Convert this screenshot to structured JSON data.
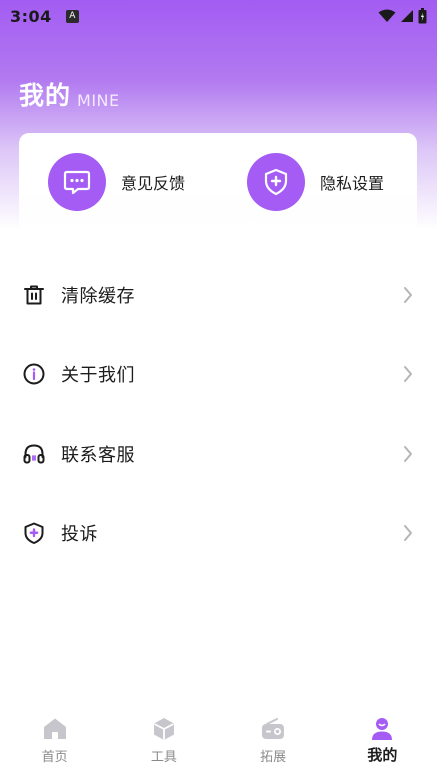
{
  "status_bar": {
    "time": "3:04",
    "notification_glyph": "A"
  },
  "header": {
    "title": "我的",
    "subtitle": "MINE"
  },
  "quick_actions": [
    {
      "label": "意见反馈",
      "icon": "chat-bubble-icon"
    },
    {
      "label": "隐私设置",
      "icon": "shield-plus-icon"
    }
  ],
  "menu": [
    {
      "label": "清除缓存",
      "icon": "trash-icon"
    },
    {
      "label": "关于我们",
      "icon": "info-icon"
    },
    {
      "label": "联系客服",
      "icon": "headset-icon"
    },
    {
      "label": "投诉",
      "icon": "complaint-shield-icon"
    }
  ],
  "bottom_nav": [
    {
      "label": "首页",
      "icon": "home-icon",
      "active": false
    },
    {
      "label": "工具",
      "icon": "cube-icon",
      "active": false
    },
    {
      "label": "拓展",
      "icon": "radio-icon",
      "active": false
    },
    {
      "label": "我的",
      "icon": "person-icon",
      "active": true
    }
  ],
  "colors": {
    "accent": "#a45cf5",
    "inactive_icon": "#c6c6cc",
    "text": "#1c1c1c"
  }
}
